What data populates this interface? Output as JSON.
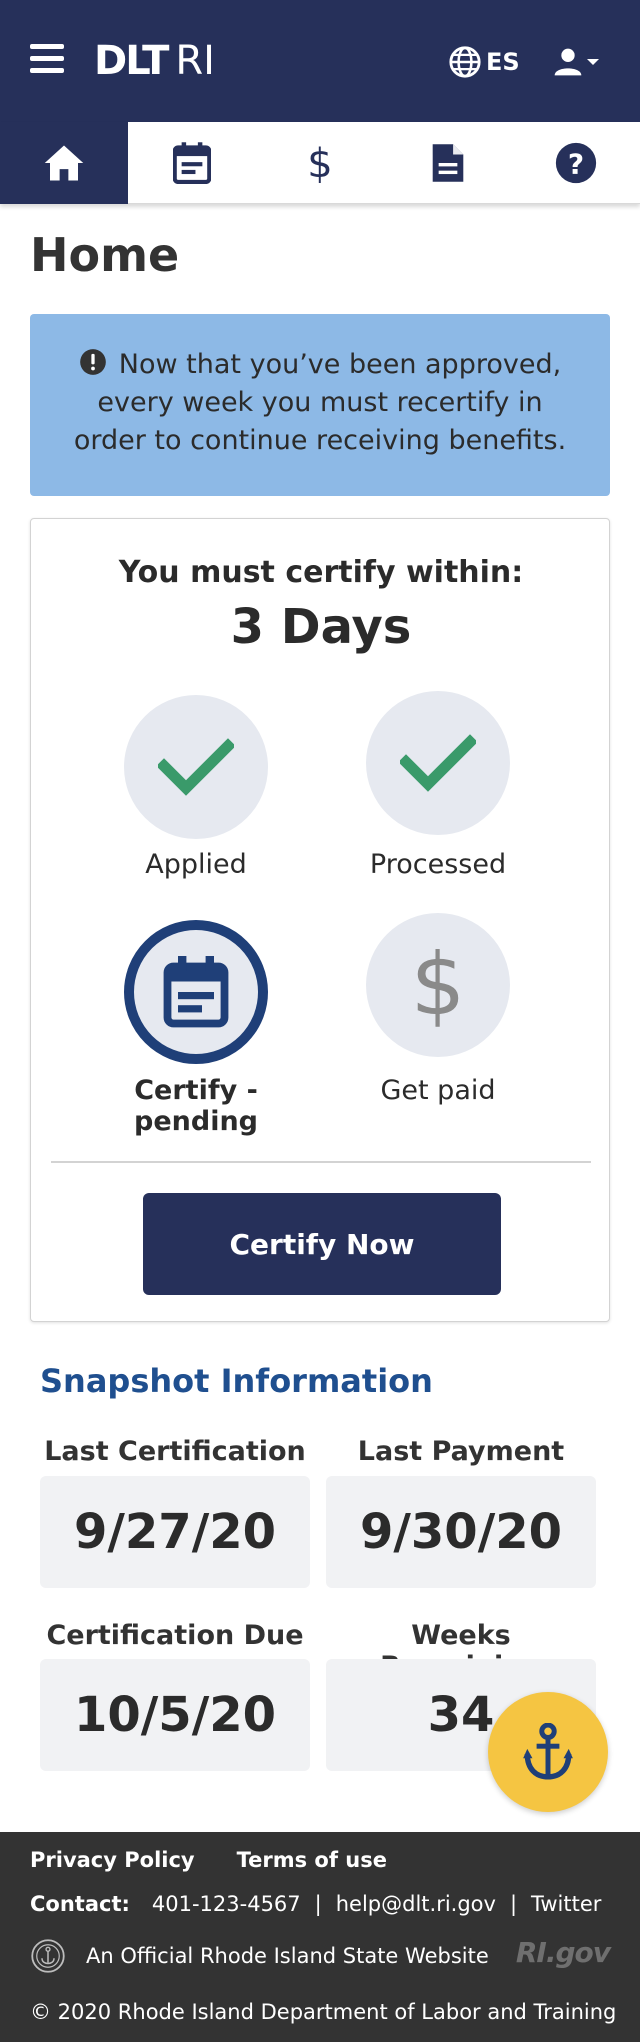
{
  "header": {
    "logo_bold": "DLT",
    "logo_regular": "RI",
    "language_label": "ES",
    "icons": {
      "menu": "hamburger-icon",
      "language": "globe-icon",
      "user": "user-icon",
      "dropdown": "caret-down-icon"
    },
    "colors": {
      "background": "#26305a"
    }
  },
  "nav": {
    "tabs": [
      {
        "icon": "home-icon",
        "active": true
      },
      {
        "icon": "calendar-icon",
        "active": false
      },
      {
        "icon": "dollar-icon",
        "active": false
      },
      {
        "icon": "document-icon",
        "active": false
      },
      {
        "icon": "help-icon",
        "active": false
      }
    ]
  },
  "page": {
    "title": "Home"
  },
  "alert": {
    "icon": "exclamation-circle-icon",
    "message": "Now that you’ve been approved, every week you must recertify in order to continue receiving benefits.",
    "color": "#8db9e6"
  },
  "status_card": {
    "heading": "You must certify within:",
    "days_left": "3 Days",
    "steps": [
      {
        "label": "Applied",
        "icon": "checkmark-icon",
        "state": "complete"
      },
      {
        "label": "Processed",
        "icon": "checkmark-icon",
        "state": "complete"
      },
      {
        "label": "Certify - pending",
        "icon": "calendar-icon",
        "state": "current"
      },
      {
        "label": "Get paid",
        "icon": "dollar-icon",
        "state": "upcoming"
      }
    ],
    "cta_label": "Certify Now",
    "colors": {
      "check": "#3a9a6a",
      "current_ring": "#1f3f78",
      "circle": "#e6e9f0"
    }
  },
  "snapshot": {
    "title": "Snapshot Information",
    "items": [
      {
        "label": "Last Certification",
        "value": "9/27/20"
      },
      {
        "label": "Last Payment",
        "value": "9/30/20"
      },
      {
        "label": "Certification Due",
        "value": "10/5/20"
      },
      {
        "label": "Weeks Remaining",
        "value": "34"
      }
    ]
  },
  "fab": {
    "icon": "anchor-icon",
    "color": "#f5c542"
  },
  "footer": {
    "links": [
      "Privacy Policy",
      "Terms of use"
    ],
    "contact_label": "Contact:",
    "phone": "401-123-4567",
    "email": "help@dlt.ri.gov",
    "twitter": "Twitter",
    "separator": "|",
    "official_text": "An Official Rhode Island State Website",
    "rigov_logo": "RI.gov",
    "copyright": "© 2020 Rhode Island Department of Labor and Training"
  }
}
